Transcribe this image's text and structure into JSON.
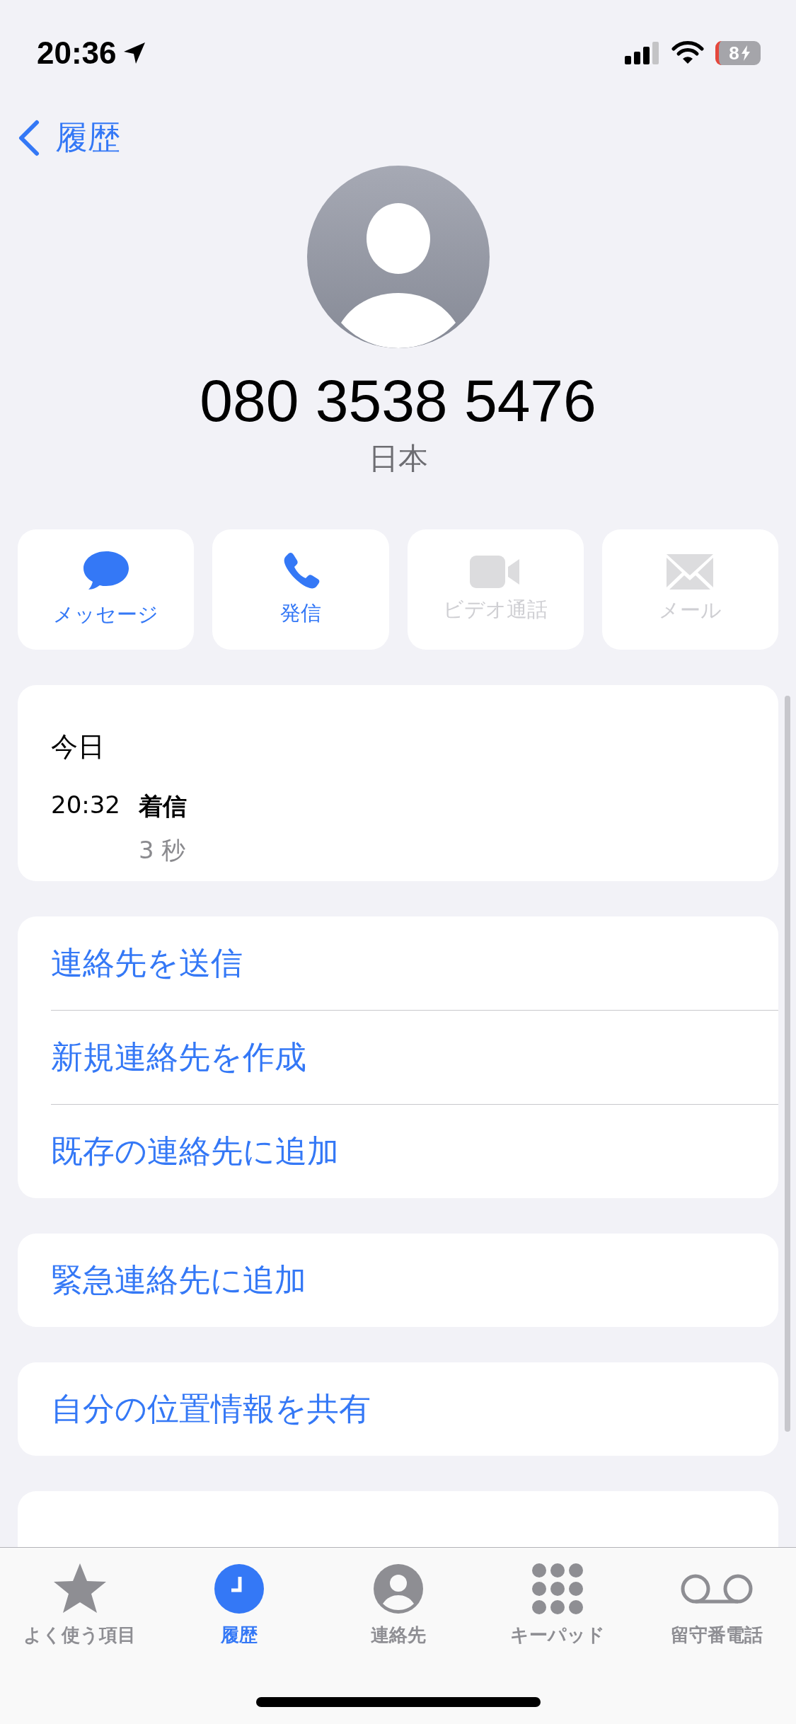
{
  "status_bar": {
    "time": "20:36",
    "battery": "8"
  },
  "nav": {
    "back_label": "履歴"
  },
  "contact": {
    "number": "080 3538 5476",
    "region": "日本"
  },
  "actions": [
    {
      "kind": "message",
      "label": "メッセージ",
      "disabled": false
    },
    {
      "kind": "call",
      "label": "発信",
      "disabled": false
    },
    {
      "kind": "video",
      "label": "ビデオ通話",
      "disabled": true
    },
    {
      "kind": "mail",
      "label": "メール",
      "disabled": true
    }
  ],
  "history": {
    "date": "今日",
    "calls": [
      {
        "time": "20:32",
        "type": "着信",
        "duration": "3 秒"
      }
    ]
  },
  "option_groups": [
    {
      "items": [
        {
          "label": "連絡先を送信",
          "destructive": false
        },
        {
          "label": "新規連絡先を作成",
          "destructive": false
        },
        {
          "label": "既存の連絡先に追加",
          "destructive": false
        }
      ]
    },
    {
      "items": [
        {
          "label": "緊急連絡先に追加",
          "destructive": false
        }
      ]
    },
    {
      "items": [
        {
          "label": "自分の位置情報を共有",
          "destructive": false
        }
      ]
    }
  ],
  "tab_bar": [
    {
      "kind": "favorites",
      "label": "よく使う項目",
      "selected": false
    },
    {
      "kind": "recents",
      "label": "履歴",
      "selected": true
    },
    {
      "kind": "contacts",
      "label": "連絡先",
      "selected": false
    },
    {
      "kind": "keypad",
      "label": "キーパッド",
      "selected": false
    },
    {
      "kind": "voicemail",
      "label": "留守番電話",
      "selected": false
    }
  ]
}
